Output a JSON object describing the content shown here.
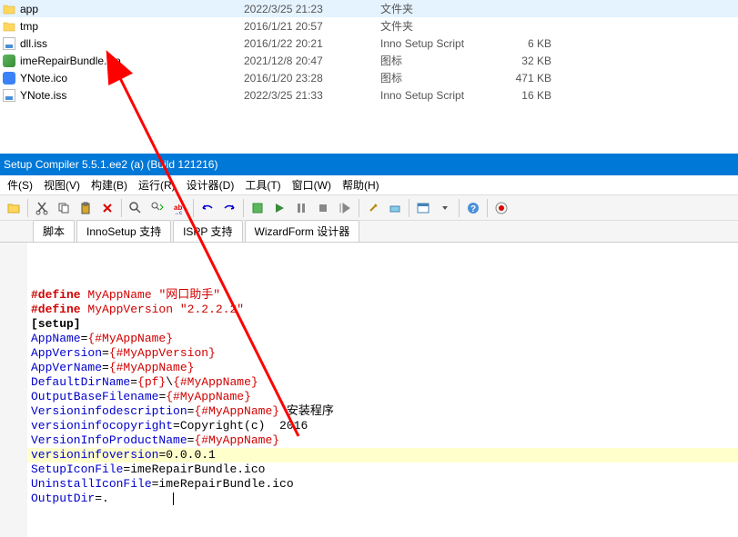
{
  "files": [
    {
      "name": "app",
      "date": "2022/3/25 21:23",
      "type": "文件夹",
      "size": "",
      "icon": "folder"
    },
    {
      "name": "tmp",
      "date": "2016/1/21 20:57",
      "type": "文件夹",
      "size": "",
      "icon": "folder"
    },
    {
      "name": "dll.iss",
      "date": "2016/1/22 20:21",
      "type": "Inno Setup Script",
      "size": "6 KB",
      "icon": "iss"
    },
    {
      "name": "imeRepairBundle.ico",
      "date": "2021/12/8 20:47",
      "type": "图标",
      "size": "32 KB",
      "icon": "ico-green"
    },
    {
      "name": "YNote.ico",
      "date": "2016/1/20 23:28",
      "type": "图标",
      "size": "471 KB",
      "icon": "ico-blue"
    },
    {
      "name": "YNote.iss",
      "date": "2022/3/25 21:33",
      "type": "Inno Setup Script",
      "size": "16 KB",
      "icon": "iss"
    }
  ],
  "titlebar": "Setup Compiler 5.5.1.ee2 (a) (Build 121216)",
  "menu": [
    "件(S)",
    "视图(V)",
    "构建(B)",
    "运行(R)",
    "设计器(D)",
    "工具(T)",
    "窗口(W)",
    "帮助(H)"
  ],
  "tabs": [
    "脚本",
    "InnoSetup 支持",
    "ISPP 支持",
    "WizardForm 设计器"
  ],
  "code": {
    "l1a": "#define",
    "l1b": "MyAppName",
    "l1c": "\"网口助手\"",
    "l2a": "#define",
    "l2b": "MyAppVersion",
    "l2c": "\"2.2.2.2\"",
    "l3": "[setup]",
    "l4k": "AppName",
    "l4e": "=",
    "l4v": "{#MyAppName}",
    "l5k": "AppVersion",
    "l5e": "=",
    "l5v": "{#MyAppVersion}",
    "l6k": "AppVerName",
    "l6e": "=",
    "l6v": "{#MyAppName}",
    "l7k": "DefaultDirName",
    "l7e": "=",
    "l7v1": "{pf}",
    "l7s": "\\",
    "l7v2": "{#MyAppName}",
    "l8k": "OutputBaseFilename",
    "l8e": "=",
    "l8v": "{#MyAppName}",
    "l9k": "Versioninfodescription",
    "l9e": "=",
    "l9v": "{#MyAppName}",
    "l9t": " 安装程序",
    "l10k": "versioninfocopyright",
    "l10e": "=Copyright(c)  2016",
    "l11k": "VersionInfoProductName",
    "l11e": "=",
    "l11v": "{#MyAppName}",
    "l12k": "versioninfoversion",
    "l12e": "=0.0.0.1",
    "l13k": "SetupIconFile",
    "l13e": "=imeRepairBundle.ico",
    "l14k": "UninstallIconFile",
    "l14e": "=imeRepairBundle.ico",
    "l15k": "OutputDir",
    "l15e": "=."
  }
}
